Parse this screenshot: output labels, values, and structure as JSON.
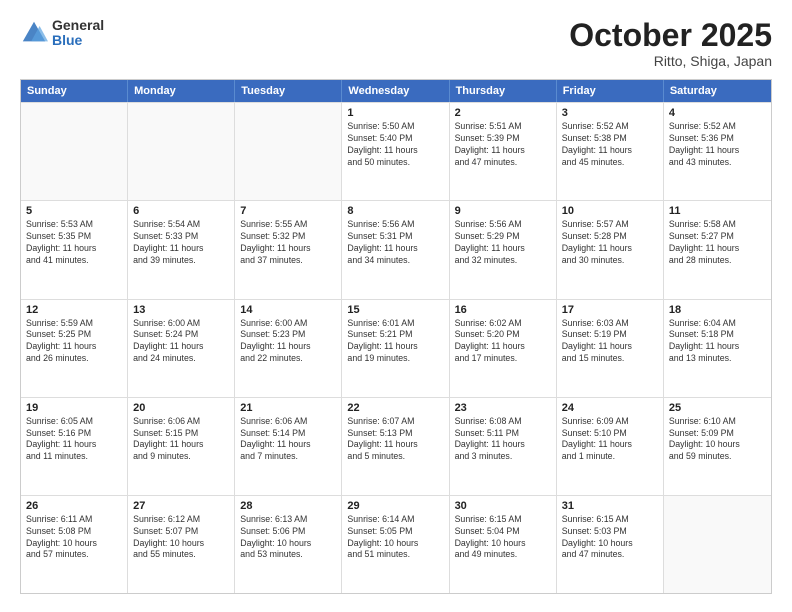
{
  "logo": {
    "general": "General",
    "blue": "Blue"
  },
  "header": {
    "month": "October 2025",
    "location": "Ritto, Shiga, Japan"
  },
  "days_of_week": [
    "Sunday",
    "Monday",
    "Tuesday",
    "Wednesday",
    "Thursday",
    "Friday",
    "Saturday"
  ],
  "weeks": [
    [
      {
        "day": "",
        "empty": true
      },
      {
        "day": "",
        "empty": true
      },
      {
        "day": "",
        "empty": true
      },
      {
        "day": "1",
        "lines": [
          "Sunrise: 5:50 AM",
          "Sunset: 5:40 PM",
          "Daylight: 11 hours",
          "and 50 minutes."
        ]
      },
      {
        "day": "2",
        "lines": [
          "Sunrise: 5:51 AM",
          "Sunset: 5:39 PM",
          "Daylight: 11 hours",
          "and 47 minutes."
        ]
      },
      {
        "day": "3",
        "lines": [
          "Sunrise: 5:52 AM",
          "Sunset: 5:38 PM",
          "Daylight: 11 hours",
          "and 45 minutes."
        ]
      },
      {
        "day": "4",
        "lines": [
          "Sunrise: 5:52 AM",
          "Sunset: 5:36 PM",
          "Daylight: 11 hours",
          "and 43 minutes."
        ]
      }
    ],
    [
      {
        "day": "5",
        "lines": [
          "Sunrise: 5:53 AM",
          "Sunset: 5:35 PM",
          "Daylight: 11 hours",
          "and 41 minutes."
        ]
      },
      {
        "day": "6",
        "lines": [
          "Sunrise: 5:54 AM",
          "Sunset: 5:33 PM",
          "Daylight: 11 hours",
          "and 39 minutes."
        ]
      },
      {
        "day": "7",
        "lines": [
          "Sunrise: 5:55 AM",
          "Sunset: 5:32 PM",
          "Daylight: 11 hours",
          "and 37 minutes."
        ]
      },
      {
        "day": "8",
        "lines": [
          "Sunrise: 5:56 AM",
          "Sunset: 5:31 PM",
          "Daylight: 11 hours",
          "and 34 minutes."
        ]
      },
      {
        "day": "9",
        "lines": [
          "Sunrise: 5:56 AM",
          "Sunset: 5:29 PM",
          "Daylight: 11 hours",
          "and 32 minutes."
        ]
      },
      {
        "day": "10",
        "lines": [
          "Sunrise: 5:57 AM",
          "Sunset: 5:28 PM",
          "Daylight: 11 hours",
          "and 30 minutes."
        ]
      },
      {
        "day": "11",
        "lines": [
          "Sunrise: 5:58 AM",
          "Sunset: 5:27 PM",
          "Daylight: 11 hours",
          "and 28 minutes."
        ]
      }
    ],
    [
      {
        "day": "12",
        "lines": [
          "Sunrise: 5:59 AM",
          "Sunset: 5:25 PM",
          "Daylight: 11 hours",
          "and 26 minutes."
        ]
      },
      {
        "day": "13",
        "lines": [
          "Sunrise: 6:00 AM",
          "Sunset: 5:24 PM",
          "Daylight: 11 hours",
          "and 24 minutes."
        ]
      },
      {
        "day": "14",
        "lines": [
          "Sunrise: 6:00 AM",
          "Sunset: 5:23 PM",
          "Daylight: 11 hours",
          "and 22 minutes."
        ]
      },
      {
        "day": "15",
        "lines": [
          "Sunrise: 6:01 AM",
          "Sunset: 5:21 PM",
          "Daylight: 11 hours",
          "and 19 minutes."
        ]
      },
      {
        "day": "16",
        "lines": [
          "Sunrise: 6:02 AM",
          "Sunset: 5:20 PM",
          "Daylight: 11 hours",
          "and 17 minutes."
        ]
      },
      {
        "day": "17",
        "lines": [
          "Sunrise: 6:03 AM",
          "Sunset: 5:19 PM",
          "Daylight: 11 hours",
          "and 15 minutes."
        ]
      },
      {
        "day": "18",
        "lines": [
          "Sunrise: 6:04 AM",
          "Sunset: 5:18 PM",
          "Daylight: 11 hours",
          "and 13 minutes."
        ]
      }
    ],
    [
      {
        "day": "19",
        "lines": [
          "Sunrise: 6:05 AM",
          "Sunset: 5:16 PM",
          "Daylight: 11 hours",
          "and 11 minutes."
        ]
      },
      {
        "day": "20",
        "lines": [
          "Sunrise: 6:06 AM",
          "Sunset: 5:15 PM",
          "Daylight: 11 hours",
          "and 9 minutes."
        ]
      },
      {
        "day": "21",
        "lines": [
          "Sunrise: 6:06 AM",
          "Sunset: 5:14 PM",
          "Daylight: 11 hours",
          "and 7 minutes."
        ]
      },
      {
        "day": "22",
        "lines": [
          "Sunrise: 6:07 AM",
          "Sunset: 5:13 PM",
          "Daylight: 11 hours",
          "and 5 minutes."
        ]
      },
      {
        "day": "23",
        "lines": [
          "Sunrise: 6:08 AM",
          "Sunset: 5:11 PM",
          "Daylight: 11 hours",
          "and 3 minutes."
        ]
      },
      {
        "day": "24",
        "lines": [
          "Sunrise: 6:09 AM",
          "Sunset: 5:10 PM",
          "Daylight: 11 hours",
          "and 1 minute."
        ]
      },
      {
        "day": "25",
        "lines": [
          "Sunrise: 6:10 AM",
          "Sunset: 5:09 PM",
          "Daylight: 10 hours",
          "and 59 minutes."
        ]
      }
    ],
    [
      {
        "day": "26",
        "lines": [
          "Sunrise: 6:11 AM",
          "Sunset: 5:08 PM",
          "Daylight: 10 hours",
          "and 57 minutes."
        ]
      },
      {
        "day": "27",
        "lines": [
          "Sunrise: 6:12 AM",
          "Sunset: 5:07 PM",
          "Daylight: 10 hours",
          "and 55 minutes."
        ]
      },
      {
        "day": "28",
        "lines": [
          "Sunrise: 6:13 AM",
          "Sunset: 5:06 PM",
          "Daylight: 10 hours",
          "and 53 minutes."
        ]
      },
      {
        "day": "29",
        "lines": [
          "Sunrise: 6:14 AM",
          "Sunset: 5:05 PM",
          "Daylight: 10 hours",
          "and 51 minutes."
        ]
      },
      {
        "day": "30",
        "lines": [
          "Sunrise: 6:15 AM",
          "Sunset: 5:04 PM",
          "Daylight: 10 hours",
          "and 49 minutes."
        ]
      },
      {
        "day": "31",
        "lines": [
          "Sunrise: 6:15 AM",
          "Sunset: 5:03 PM",
          "Daylight: 10 hours",
          "and 47 minutes."
        ]
      },
      {
        "day": "",
        "empty": true
      }
    ]
  ]
}
